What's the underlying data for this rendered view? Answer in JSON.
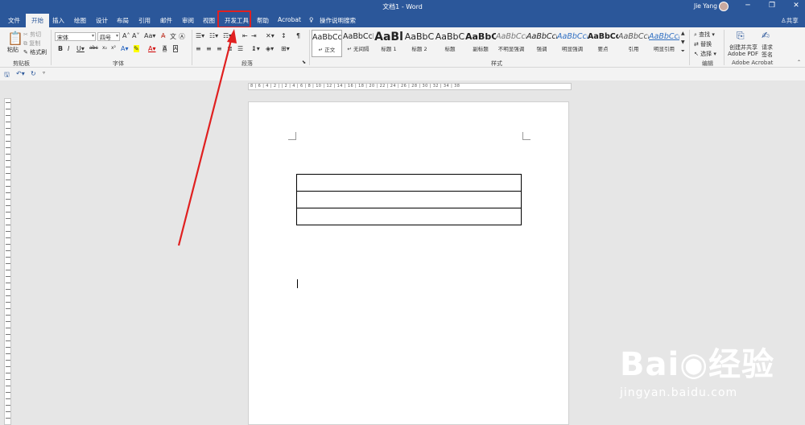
{
  "title_bar": {
    "document_title": "文档1  -  Word",
    "user_name": "Jie Yang",
    "window_controls": [
      "─",
      "❐",
      "✕"
    ]
  },
  "tabs": [
    "文件",
    "开始",
    "插入",
    "绘图",
    "设计",
    "布局",
    "引用",
    "邮件",
    "审阅",
    "视图",
    "开发工具",
    "帮助",
    "Acrobat"
  ],
  "active_tab": "开始",
  "tell_me": "操作说明搜索",
  "share_label": "共享",
  "clipboard": {
    "paste": "粘贴",
    "cut": "剪切",
    "copy": "复制",
    "format_painter": "格式刷",
    "group_label": "剪贴板"
  },
  "font": {
    "name": "宋体",
    "size": "四号",
    "group_label": "字体"
  },
  "paragraph": {
    "group_label": "段落"
  },
  "styles": {
    "items": [
      {
        "preview": "AaBbCcDc",
        "name": "↵ 正文"
      },
      {
        "preview": "AaBbCcDc",
        "name": "↵ 无间隔"
      },
      {
        "preview": "AaBl",
        "name": "标题 1"
      },
      {
        "preview": "AaBbC",
        "name": "标题 2"
      },
      {
        "preview": "AaBbC",
        "name": "标题"
      },
      {
        "preview": "AaBbC",
        "name": "副标题"
      },
      {
        "preview": "AaBbCcDc",
        "name": "不明显强调"
      },
      {
        "preview": "AaBbCcDc",
        "name": "强调"
      },
      {
        "preview": "AaBbCcDc",
        "name": "明显强调"
      },
      {
        "preview": "AaBbCcDc",
        "name": "要点"
      },
      {
        "preview": "AaBbCcDc",
        "name": "引用"
      },
      {
        "preview": "AaBbCcDc",
        "name": "明显引用"
      }
    ],
    "group_label": "样式"
  },
  "editing": {
    "find": "查找",
    "replace": "替换",
    "select": "选择",
    "group_label": "编辑"
  },
  "acrobat": {
    "create_pdf": "创建并共享",
    "create_pdf_2": "Adobe PDF",
    "sign": "请求",
    "sign_2": "签名",
    "group_label": "Adobe Acrobat"
  },
  "ruler_text": "8 | 6 | 4 | 2 |   | 2 | 4 | 6 | 8 | 10 | 12 | 14 | 16 | 18 | 20 | 22 | 24 | 26 | 28 | 30 | 32 | 34 | 38",
  "document": {
    "table_rows": 3
  },
  "watermark": {
    "brand": "Bai◉经验",
    "url": "jingyan.baidu.com"
  },
  "colors": {
    "brand_blue": "#2b579a",
    "highlight_red": "#e02020"
  }
}
